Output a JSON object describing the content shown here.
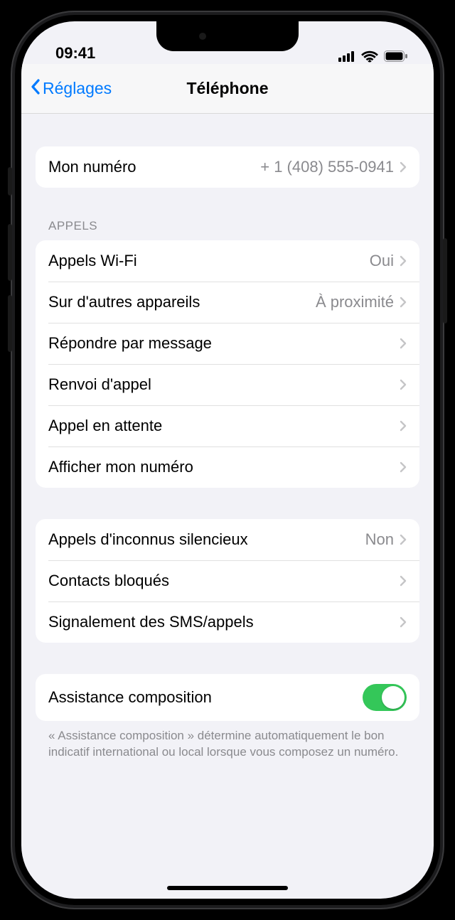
{
  "status": {
    "time": "09:41"
  },
  "nav": {
    "back": "Réglages",
    "title": "Téléphone"
  },
  "myNumber": {
    "label": "Mon numéro",
    "value": "+ 1 (408) 555-0941"
  },
  "callsHeader": "APPELS",
  "calls": {
    "wifi": {
      "label": "Appels Wi-Fi",
      "value": "Oui"
    },
    "other": {
      "label": "Sur d'autres appareils",
      "value": "À proximité"
    },
    "respond": {
      "label": "Répondre par message"
    },
    "forward": {
      "label": "Renvoi d'appel"
    },
    "waiting": {
      "label": "Appel en attente"
    },
    "showId": {
      "label": "Afficher mon numéro"
    }
  },
  "silence": {
    "unknown": {
      "label": "Appels d'inconnus silencieux",
      "value": "Non"
    },
    "blocked": {
      "label": "Contacts bloqués"
    },
    "report": {
      "label": "Signalement des SMS/appels"
    }
  },
  "dialAssist": {
    "label": "Assistance composition",
    "on": true
  },
  "dialAssistFooter": "« Assistance composition » détermine automatiquement le bon indicatif international ou local lorsque vous composez un numéro."
}
